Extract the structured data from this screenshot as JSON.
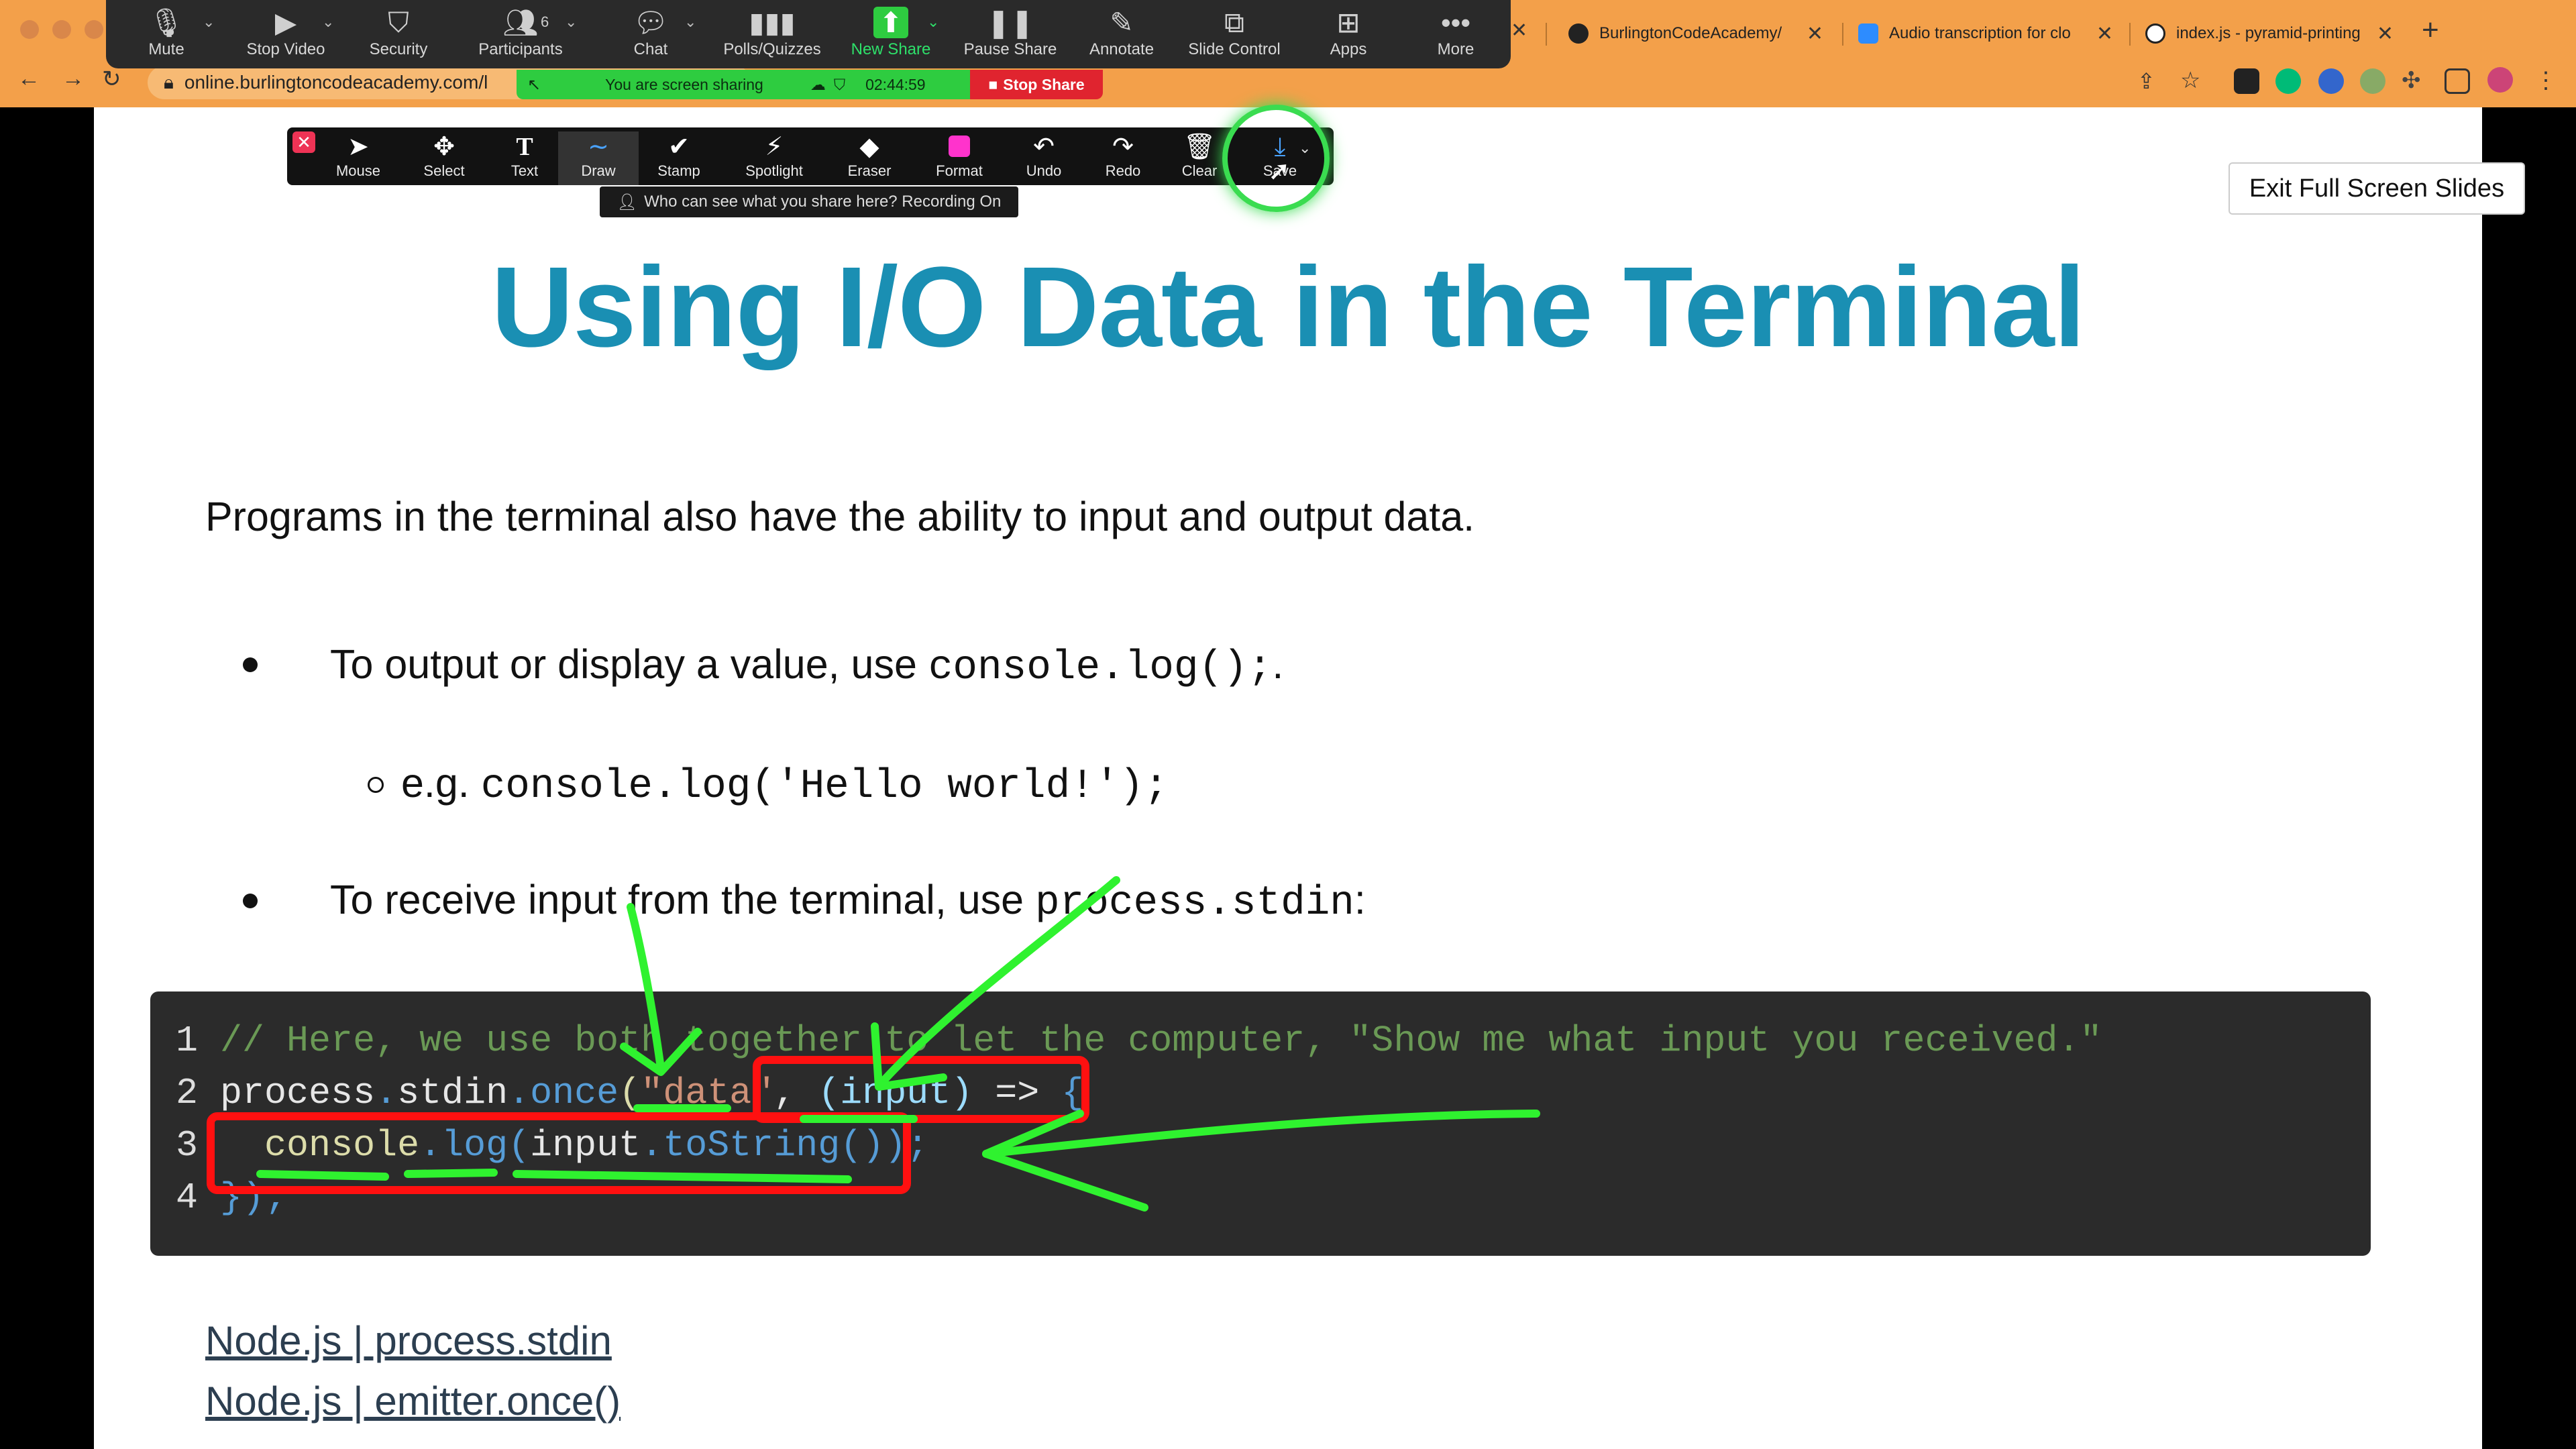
{
  "browser": {
    "tabs": [
      {
        "label": "BurlingtonCodeAcademy/",
        "icon": "github-icon"
      },
      {
        "label": "Audio transcription for clo",
        "icon": "zoom-icon"
      },
      {
        "label": "index.js - pyramid-printing",
        "icon": "glitch-icon"
      }
    ],
    "address": "online.burlingtoncodeacademy.com/l"
  },
  "zoom": {
    "buttons": [
      {
        "label": "Mute",
        "icon": "microphone-icon"
      },
      {
        "label": "Stop Video",
        "icon": "video-camera-icon"
      },
      {
        "label": "Security",
        "icon": "shield-icon"
      },
      {
        "label": "Participants",
        "icon": "participants-icon",
        "count": "6"
      },
      {
        "label": "Chat",
        "icon": "chat-bubble-icon"
      },
      {
        "label": "Polls/Quizzes",
        "icon": "bar-chart-icon"
      },
      {
        "label": "New Share",
        "icon": "share-arrow-icon"
      },
      {
        "label": "Pause Share",
        "icon": "pause-icon"
      },
      {
        "label": "Annotate",
        "icon": "pen-icon"
      },
      {
        "label": "Slide Control",
        "icon": "slide-control-icon"
      },
      {
        "label": "Apps",
        "icon": "apps-icon"
      },
      {
        "label": "More",
        "icon": "more-dots-icon"
      }
    ],
    "sharing_text": "You are screen sharing",
    "timer": "02:44:59",
    "stop_share": "Stop Share",
    "who_can_see": "Who can see what you share here? Recording On"
  },
  "annotate": {
    "tools": [
      {
        "label": "Mouse",
        "icon": "cursor-icon"
      },
      {
        "label": "Select",
        "icon": "move-arrows-icon"
      },
      {
        "label": "Text",
        "icon": "text-t-icon"
      },
      {
        "label": "Draw",
        "icon": "squiggle-icon"
      },
      {
        "label": "Stamp",
        "icon": "checkmark-icon"
      },
      {
        "label": "Spotlight",
        "icon": "spotlight-wand-icon"
      },
      {
        "label": "Eraser",
        "icon": "eraser-icon"
      },
      {
        "label": "Format",
        "icon": "format-swatch-icon"
      },
      {
        "label": "Undo",
        "icon": "undo-icon"
      },
      {
        "label": "Redo",
        "icon": "redo-icon"
      },
      {
        "label": "Clear",
        "icon": "trash-icon"
      },
      {
        "label": "Save",
        "icon": "save-icon"
      }
    ],
    "format_color": "#ff33cc"
  },
  "slide": {
    "exit_button": "Exit Full Screen Slides",
    "title": "Using I/O Data in the Terminal",
    "intro": "Programs in the terminal also have the ability to input and output data.",
    "bullet1_text": "To output or display a value, use ",
    "bullet1_code": "console.log();",
    "bullet1_end": ".",
    "sub_prefix": "e.g. ",
    "sub_code": "console.log('Hello world!');",
    "bullet2_text": "To receive input from the terminal, use ",
    "bullet2_code": "process.stdin",
    "bullet2_end": ":",
    "code": {
      "line_numbers": [
        "1",
        "2",
        "3",
        "4"
      ],
      "line1": "// Here, we use both together to let the computer, \"Show me what input you received.\"",
      "line2": {
        "obj": "process",
        "dot1": ".",
        "prop": "stdin",
        "dot2": ".",
        "method": "once",
        "open": "(",
        "str": "\"data\"",
        "comma": ", ",
        "param": "(input)",
        "arrow": " => ",
        "brace": "{"
      },
      "line3": {
        "indent": "  ",
        "obj": "console",
        "dot": ".",
        "method": "log",
        "open": "(",
        "arg": "input",
        "dot2": ".",
        "method2": "toString",
        "close": "());"
      },
      "line4": "});"
    },
    "links": [
      "Node.js | process.stdin",
      "Node.js | emitter.once()"
    ]
  },
  "colors": {
    "title": "#1a8fb3",
    "annotation_green": "#2ff22f",
    "annotation_red": "#ff1010",
    "browser_chrome": "#f3a04a"
  }
}
